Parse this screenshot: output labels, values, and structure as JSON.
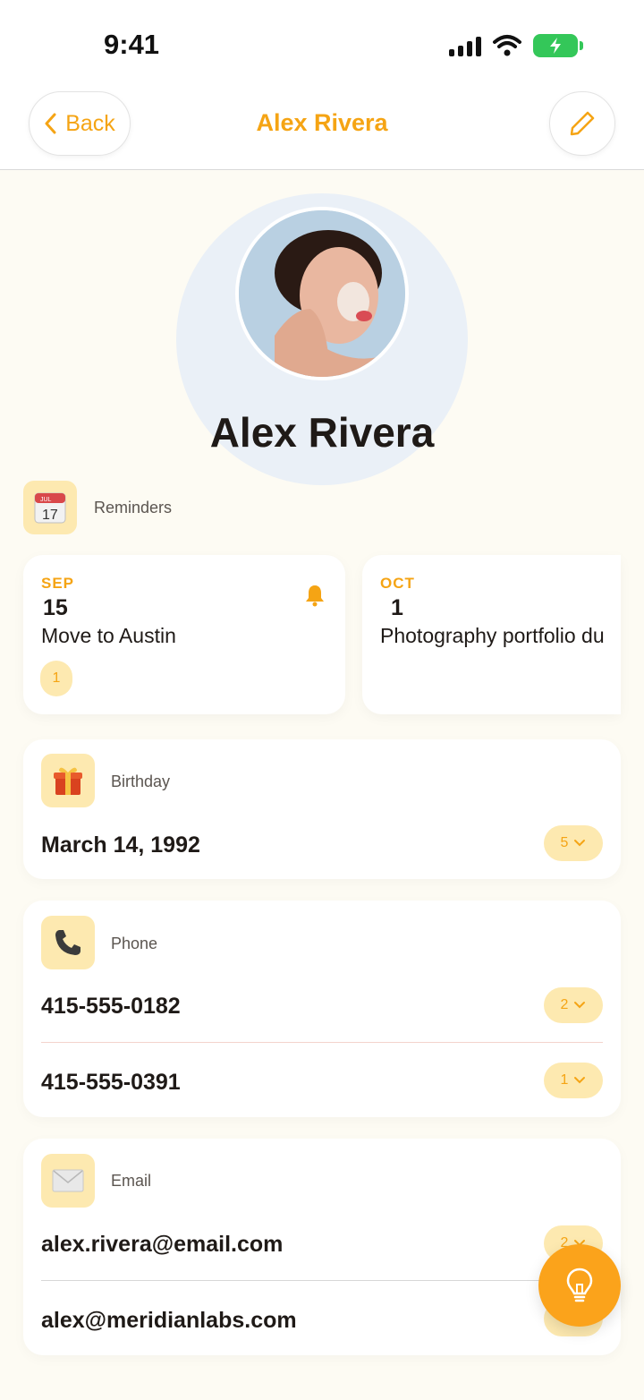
{
  "status_bar": {
    "time": "9:41"
  },
  "nav": {
    "back_label": "Back",
    "title": "Alex Rivera"
  },
  "profile": {
    "name": "Alex Rivera"
  },
  "reminders": {
    "label": "Reminders",
    "calendar_month": "JUL",
    "calendar_day": "17",
    "items": [
      {
        "month": "SEP",
        "day": "15",
        "title": "Move to Austin",
        "count": "1",
        "has_alert": true
      },
      {
        "month": "OCT",
        "day": "1",
        "title": "Photography portfolio du",
        "count": "",
        "has_alert": false
      }
    ]
  },
  "birthday": {
    "label": "Birthday",
    "value": "March 14, 1992",
    "count": "5"
  },
  "phone": {
    "label": "Phone",
    "items": [
      {
        "value": "415-555-0182",
        "count": "2"
      },
      {
        "value": "415-555-0391",
        "count": "1"
      }
    ]
  },
  "email": {
    "label": "Email",
    "items": [
      {
        "value": "alex.rivera@email.com",
        "count": "2"
      },
      {
        "value": "alex@meridianlabs.com",
        "count": "1"
      }
    ]
  },
  "colors": {
    "accent": "#f5a414",
    "tile": "#fde9b0",
    "fab": "#fba31b",
    "background": "#fdfbf3"
  }
}
